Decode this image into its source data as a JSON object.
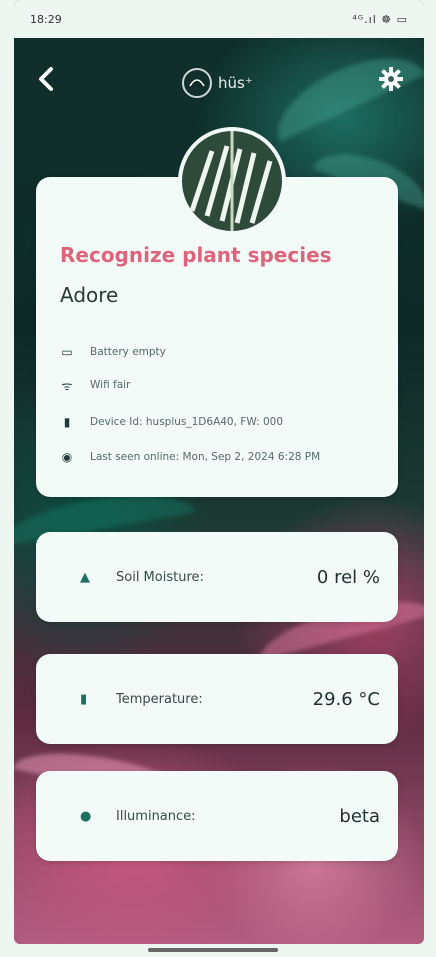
{
  "status_bar": {
    "time": "18:29",
    "icons": "⁴ᴳ.ıl ☸ ▭"
  },
  "header": {
    "back_icon": "chevron-left-icon",
    "logo_text": "hüs⁺",
    "settings_icon": "gear-icon"
  },
  "plant": {
    "recognize_label": "Recognize plant species",
    "name": "Adore"
  },
  "device_info": [
    {
      "icon": "battery-icon",
      "glyph": "▭",
      "text": "Battery empty"
    },
    {
      "icon": "wifi-icon",
      "glyph": "ᯤ",
      "text": "Wifi fair"
    },
    {
      "icon": "device-icon",
      "glyph": "▮",
      "text": "Device Id: husplus_1D6A40, FW: 000"
    },
    {
      "icon": "eye-icon",
      "glyph": "◉",
      "text": "Last seen online: Mon, Sep 2, 2024 6:28 PM"
    }
  ],
  "metrics": [
    {
      "icon": "water-drop-icon",
      "glyph": "▲",
      "label": "Soil Moisture:",
      "value": "0 rel %"
    },
    {
      "icon": "thermometer-icon",
      "glyph": "▮",
      "label": "Temperature:",
      "value": "29.6 °C"
    },
    {
      "icon": "sun-icon",
      "glyph": "●",
      "label": "Illuminance:",
      "value": "beta"
    }
  ],
  "colors": {
    "accent_pink": "#e0637c",
    "card_bg": "#f2fbf8",
    "icon_teal": "#1e6f63"
  }
}
